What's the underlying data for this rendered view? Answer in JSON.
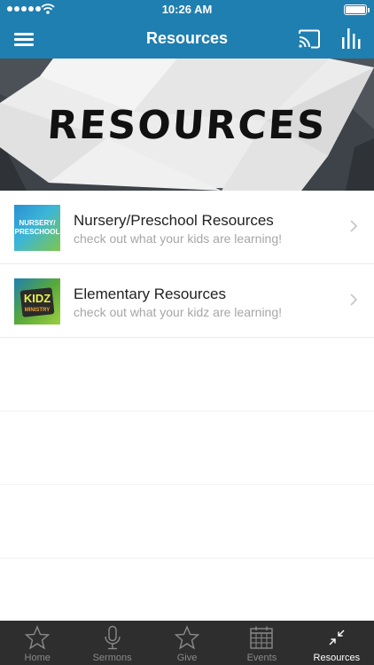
{
  "status_bar": {
    "time": "10:26 AM"
  },
  "nav": {
    "title": "Resources",
    "icons": [
      "menu-icon",
      "cast-icon",
      "bar-chart-icon"
    ]
  },
  "banner": {
    "title": "RESOURCES"
  },
  "resources": [
    {
      "title": "Nursery/Preschool Resources",
      "subtitle": "check out what your kids are learning!",
      "thumb_label_1": "NURSERY/",
      "thumb_label_2": "PRESCHOOL"
    },
    {
      "title": "Elementary Resources",
      "subtitle": "check out what your kidz are learning!",
      "thumb_label": "KIDZ",
      "thumb_sublabel": "MINISTRY"
    }
  ],
  "tab_bar": {
    "items": [
      {
        "label": "Home",
        "icon": "star-icon",
        "active": false
      },
      {
        "label": "Sermons",
        "icon": "microphone-icon",
        "active": false
      },
      {
        "label": "Give",
        "icon": "star-icon",
        "active": false
      },
      {
        "label": "Events",
        "icon": "calendar-icon",
        "active": false
      },
      {
        "label": "Resources",
        "icon": "collapse-arrows-icon",
        "active": true
      }
    ]
  },
  "colors": {
    "primary": "#1f7fb0",
    "tab_bar": "#2e2e2e",
    "subtitle": "#a6a6a6"
  }
}
